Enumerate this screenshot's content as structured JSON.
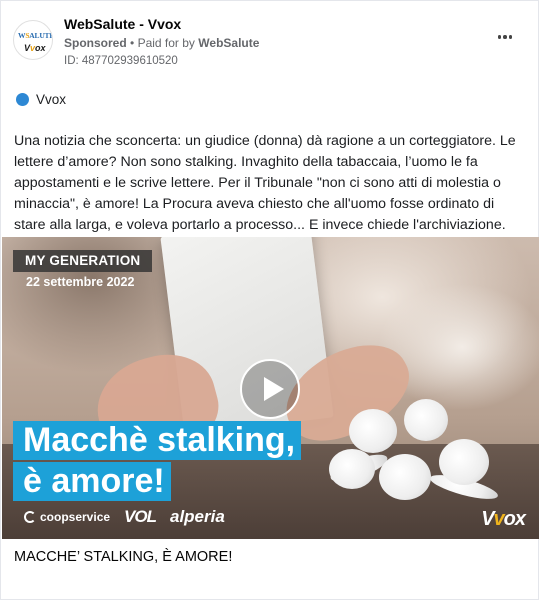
{
  "header": {
    "page_name": "WebSalute - Vvox",
    "sponsored": "Sponsored",
    "separator": "•",
    "paid_for_by": "Paid for by",
    "paid_for_name": "WebSalute",
    "ad_id": "ID: 487702939610520",
    "avatar": {
      "line1": "WSALUTE",
      "line2": "VVOX"
    },
    "more_icon": "ellipsis-icon"
  },
  "platform": {
    "label": "Vvox",
    "color": "#2d88d4"
  },
  "post": {
    "text": "Una notizia che sconcerta: un giudice (donna) dà ragione a un corteggiatore. Le lettere d’amore? Non sono stalking. Invaghito della tabaccaia, l’uomo le fa appostamenti e le scrive lettere. Per il Tribunale \"non ci sono atti di molestia o minaccia\", è amore! La Procura aveva chiesto che all'uomo fosse ordinato di stare alla larga, e voleva portarlo a processo... E invece chiede l'archiviazione. Materia ..."
  },
  "media": {
    "tag": "MY GENERATION",
    "date": "22 settembre 2022",
    "headline_line1": "Macchè stalking,",
    "headline_line2": "è amore!",
    "logo_coop": "coopservice",
    "logo_vol": "VOL",
    "logo_alperia": "alperia",
    "brand": "VVOX",
    "accent": "#1da1d8",
    "play_icon": "play-icon"
  },
  "caption": "MACCHE’ STALKING, È AMORE!"
}
